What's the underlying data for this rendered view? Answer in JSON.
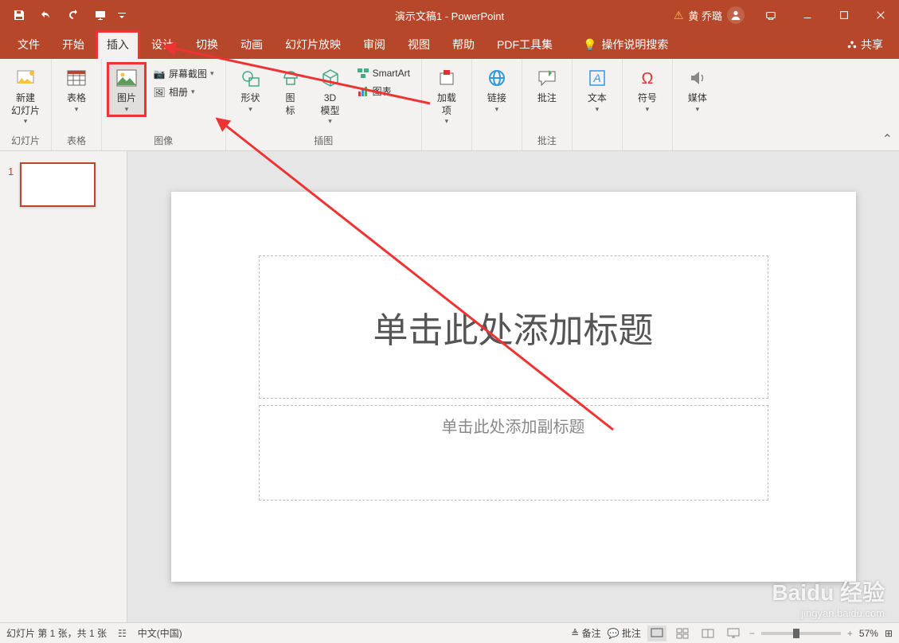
{
  "titlebar": {
    "doc_title": "演示文稿1 - PowerPoint",
    "user_name": "黄 乔璐"
  },
  "tabs": {
    "file": "文件",
    "home": "开始",
    "insert": "插入",
    "design": "设计",
    "transitions": "切换",
    "animations": "动画",
    "slideshow": "幻灯片放映",
    "review": "审阅",
    "view": "视图",
    "help": "帮助",
    "pdf": "PDF工具集",
    "tell_me": "操作说明搜索",
    "share": "共享"
  },
  "ribbon": {
    "new_slide": "新建\n幻灯片",
    "slides_group": "幻灯片",
    "table": "表格",
    "tables_group": "表格",
    "picture": "图片",
    "screenshot": "屏幕截图",
    "album": "相册",
    "images_group": "图像",
    "shapes": "形状",
    "icons": "图\n标",
    "model3d": "3D\n模型",
    "smartart": "SmartArt",
    "chart": "图表",
    "illustrations_group": "插图",
    "addins": "加载\n项",
    "links": "链接",
    "comment": "批注",
    "comments_group": "批注",
    "text": "文本",
    "symbol": "符号",
    "media": "媒体"
  },
  "slide": {
    "title_placeholder": "单击此处添加标题",
    "subtitle_placeholder": "单击此处添加副标题",
    "thumb_num": "1"
  },
  "statusbar": {
    "slide_info": "幻灯片 第 1 张，共 1 张",
    "language": "中文(中国)",
    "notes": "备注",
    "comments": "批注",
    "zoom": "57%"
  },
  "watermark": {
    "main": "Baidu 经验",
    "sub": "jingyan.baidu.com"
  }
}
